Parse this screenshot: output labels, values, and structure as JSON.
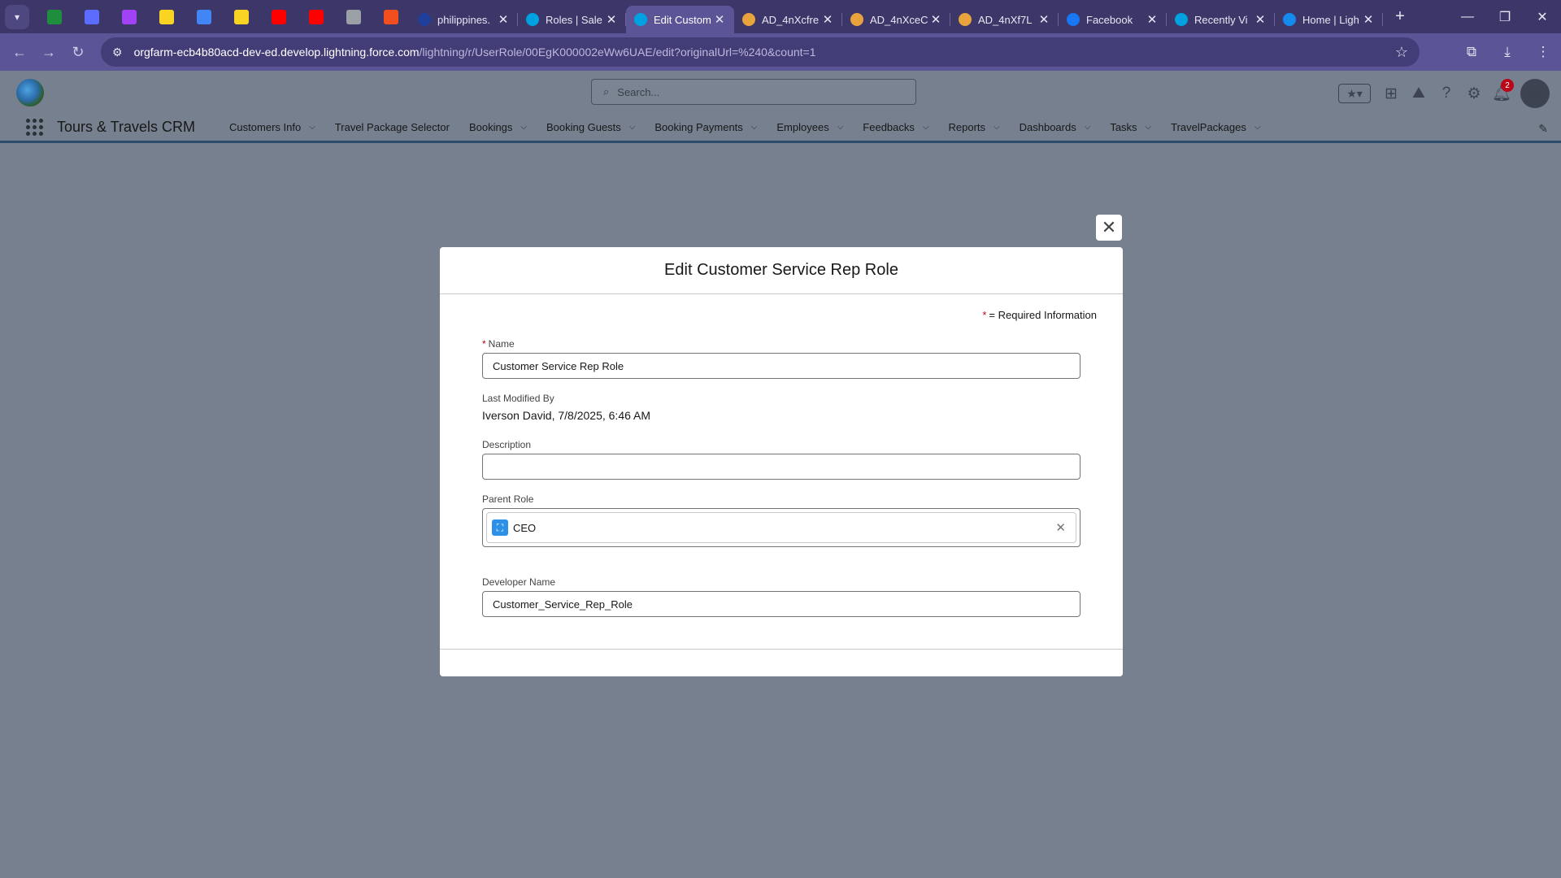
{
  "browser": {
    "tabs": [
      {
        "title": "philippines.",
        "favicon": "sw-icon",
        "color": "#1f3f9a",
        "active": false
      },
      {
        "title": "Roles | Sale",
        "favicon": "salesforce-cloud-icon",
        "color": "#00a1e0",
        "active": false
      },
      {
        "title": "Edit Custom",
        "favicon": "salesforce-cloud-icon",
        "color": "#00a1e0",
        "active": true
      },
      {
        "title": "AD_4nXcfre",
        "favicon": "pinwheel-icon",
        "color": "#e8a33d",
        "active": false
      },
      {
        "title": "AD_4nXceC",
        "favicon": "pinwheel-icon",
        "color": "#e8a33d",
        "active": false
      },
      {
        "title": "AD_4nXf7L",
        "favicon": "pinwheel-icon",
        "color": "#e8a33d",
        "active": false
      },
      {
        "title": "Facebook",
        "favicon": "facebook-icon",
        "color": "#1877f2",
        "active": false
      },
      {
        "title": "Recently Vi",
        "favicon": "salesforce-cloud-icon",
        "color": "#00a1e0",
        "active": false
      },
      {
        "title": "Home | Ligh",
        "favicon": "trailhead-icon",
        "color": "#1589ee",
        "active": false
      }
    ],
    "pinned_colors": [
      "#1e8e3e",
      "#5b6cff",
      "#a142f4",
      "#f9d423",
      "#4285f4",
      "#f9d423",
      "#ff0000",
      "#ff0000",
      "#9aa0a6",
      "#f24e1e"
    ],
    "url_host": "orgfarm-ecb4b80acd-dev-ed.develop.lightning.force.com",
    "url_path": "/lightning/r/UserRole/00EgK000002eWw6UAE/edit?originalUrl=%240&count=1"
  },
  "header": {
    "search_placeholder": "Search...",
    "notification_count": "2"
  },
  "app": {
    "name": "Tours & Travels CRM",
    "nav": [
      {
        "label": "Customers Info",
        "dropdown": true
      },
      {
        "label": "Travel Package Selector",
        "dropdown": false
      },
      {
        "label": "Bookings",
        "dropdown": true
      },
      {
        "label": "Booking Guests",
        "dropdown": true
      },
      {
        "label": "Booking Payments",
        "dropdown": true
      },
      {
        "label": "Employees",
        "dropdown": true
      },
      {
        "label": "Feedbacks",
        "dropdown": true
      },
      {
        "label": "Reports",
        "dropdown": true
      },
      {
        "label": "Dashboards",
        "dropdown": true
      },
      {
        "label": "Tasks",
        "dropdown": true
      },
      {
        "label": "TravelPackages",
        "dropdown": true
      }
    ]
  },
  "modal": {
    "title": "Edit Customer Service Rep Role",
    "required_marker": "*",
    "required_note": "= Required Information",
    "name_label": "Name",
    "name_value": "Customer Service Rep Role",
    "last_modified_label": "Last Modified By",
    "last_modified_value": "Iverson David, 7/8/2025, 6:46 AM",
    "description_label": "Description",
    "description_value": "",
    "parent_role_label": "Parent Role",
    "parent_role_value": "CEO",
    "developer_name_label": "Developer Name",
    "developer_name_value": "Customer_Service_Rep_Role"
  }
}
